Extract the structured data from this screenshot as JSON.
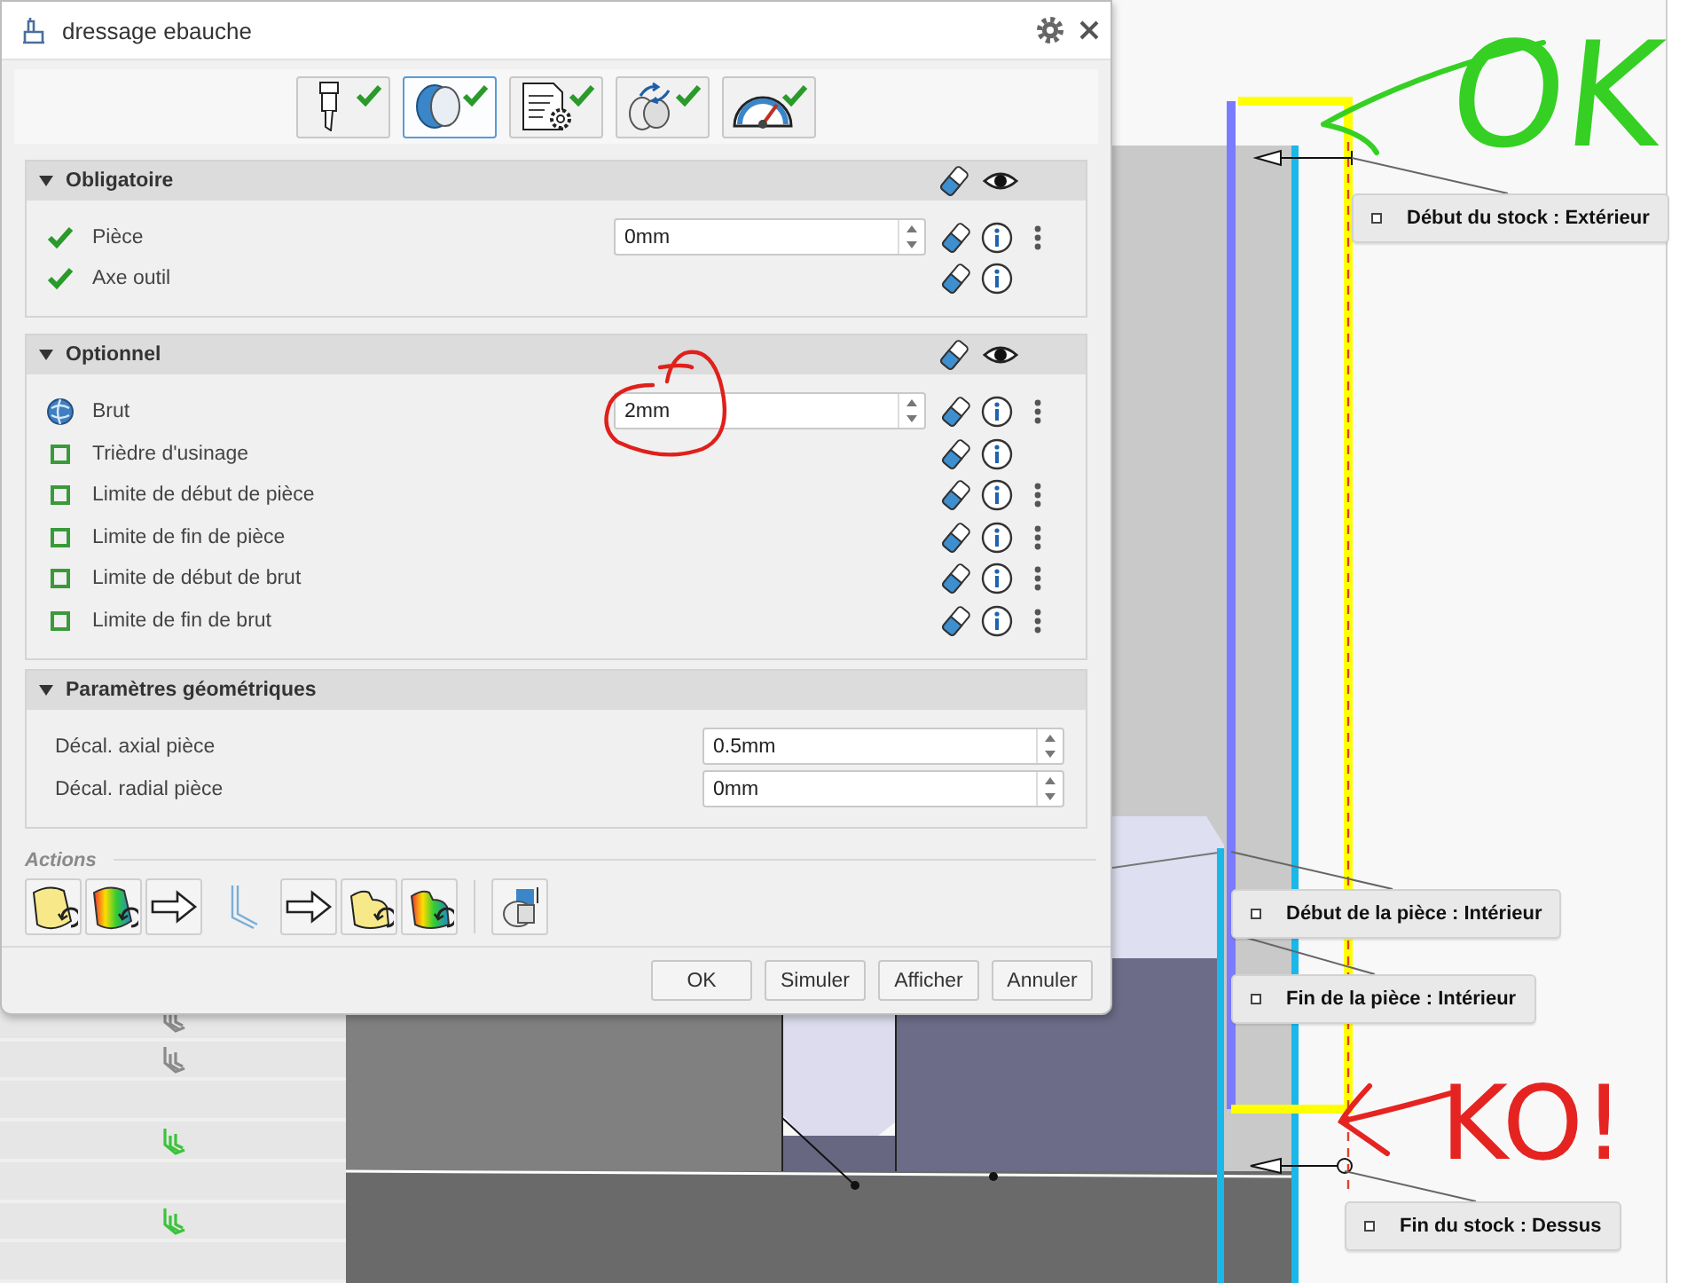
{
  "dialog": {
    "title": "dressage ebauche",
    "tabs": [
      {
        "selected": false,
        "done": true
      },
      {
        "selected": true,
        "done": true
      },
      {
        "selected": false,
        "done": true
      },
      {
        "selected": false,
        "done": true
      },
      {
        "selected": false,
        "done": true
      }
    ],
    "sections": [
      {
        "title": "Obligatoire",
        "expanded": true,
        "kind": "selection",
        "has_tools": true,
        "rows": [
          {
            "label": "Pièce",
            "kind": "check",
            "value": "0mm",
            "has_menu": true,
            "circled": false
          },
          {
            "label": "Axe outil",
            "kind": "check",
            "has_menu": false,
            "circled": false
          }
        ]
      },
      {
        "title": "Optionnel",
        "expanded": true,
        "kind": "selection",
        "has_tools": true,
        "rows": [
          {
            "label": "Brut",
            "kind": "stock",
            "value": "2mm",
            "has_menu": true,
            "circled": true
          },
          {
            "label": "Trièdre d'usinage",
            "kind": "square",
            "has_menu": false,
            "circled": false
          },
          {
            "label": "Limite de début de pièce",
            "kind": "square",
            "has_menu": true,
            "circled": false
          },
          {
            "label": "Limite de fin de pièce",
            "kind": "square",
            "has_menu": true,
            "circled": false
          },
          {
            "label": "Limite de début de brut",
            "kind": "square",
            "has_menu": true,
            "circled": false
          },
          {
            "label": "Limite de fin de brut",
            "kind": "square",
            "has_menu": true,
            "circled": false
          }
        ]
      },
      {
        "title": "Paramètres géométriques",
        "expanded": true,
        "kind": "parameters",
        "has_tools": false,
        "rows": [
          {
            "label": "Décal. axial pièce",
            "value": "0.5mm"
          },
          {
            "label": "Décal. radial pièce",
            "value": "0mm"
          }
        ]
      }
    ],
    "actions": {
      "label": "Actions"
    },
    "buttons": [
      "OK",
      "Simuler",
      "Afficher",
      "Annuler"
    ]
  },
  "tree_rows": [
    {
      "kind": "inactive"
    },
    {
      "kind": "inactive"
    },
    {
      "kind": "blank"
    },
    {
      "kind": "active"
    },
    {
      "kind": "blank"
    },
    {
      "kind": "active"
    },
    {
      "kind": "blank"
    }
  ],
  "callouts": [
    {
      "text": "Début du stock : Extérieur"
    },
    {
      "text": "Début de la pièce : Intérieur"
    },
    {
      "text": "Fin de la pièce : Intérieur"
    },
    {
      "text": "Fin du stock : Dessus"
    }
  ],
  "annotations": [
    {
      "kind": "approval",
      "text": "OK",
      "color": "#35d023"
    },
    {
      "kind": "rejection",
      "text": "KO!",
      "color": "#e52421"
    }
  ]
}
